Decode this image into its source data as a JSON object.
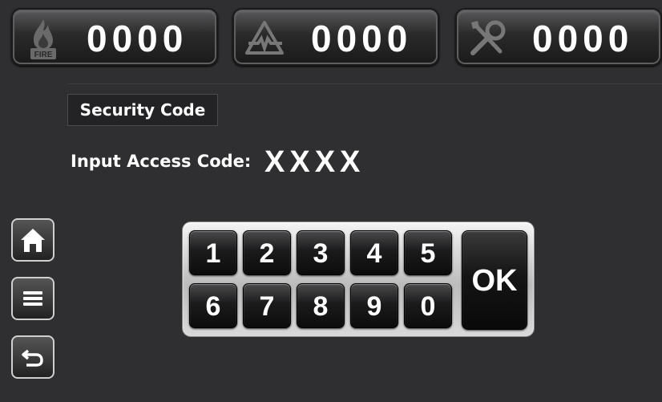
{
  "counters": [
    {
      "icon": "fire-icon",
      "icon_text": "FIRE",
      "value": "0000"
    },
    {
      "icon": "fault-warning-icon",
      "value": "0000"
    },
    {
      "icon": "tools-icon",
      "value": "0000"
    }
  ],
  "security": {
    "title": "Security Code",
    "access_label": "Input Access Code:",
    "access_value": "XXXX"
  },
  "sidebar": {
    "home": "home-icon",
    "menu": "menu-icon",
    "back": "back-arrow-icon"
  },
  "keypad": {
    "row1": [
      "1",
      "2",
      "3",
      "4",
      "5"
    ],
    "row2": [
      "6",
      "7",
      "8",
      "9",
      "0"
    ],
    "ok_label": "OK"
  }
}
